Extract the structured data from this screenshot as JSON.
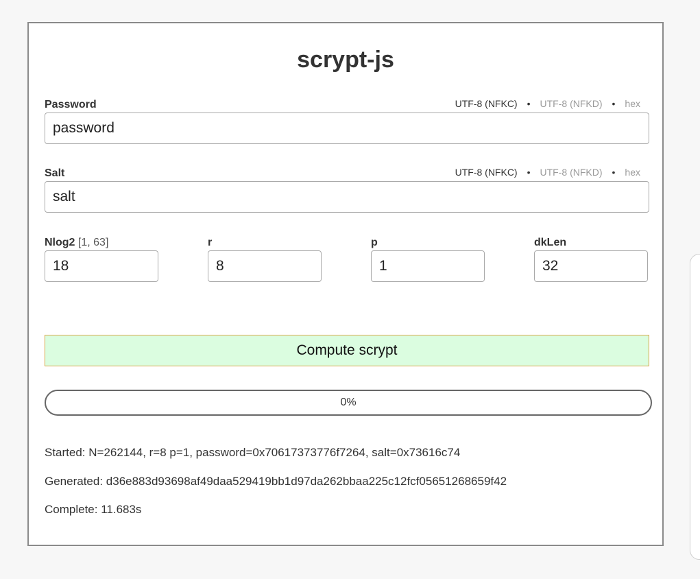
{
  "title": "scrypt-js",
  "password": {
    "label": "Password",
    "value": "password",
    "encodings": [
      "UTF-8 (NFKC)",
      "UTF-8 (NFKD)",
      "hex"
    ],
    "selected_encoding": "UTF-8 (NFKC)"
  },
  "salt": {
    "label": "Salt",
    "value": "salt",
    "encodings": [
      "UTF-8 (NFKC)",
      "UTF-8 (NFKD)",
      "hex"
    ],
    "selected_encoding": "UTF-8 (NFKC)"
  },
  "params": {
    "nlog2": {
      "label": "Nlog2",
      "range": "[1, 63]",
      "value": "18"
    },
    "r": {
      "label": "r",
      "value": "8"
    },
    "p": {
      "label": "p",
      "value": "1"
    },
    "dklen": {
      "label": "dkLen",
      "value": "32"
    }
  },
  "compute_label": "Compute scrypt",
  "progress": {
    "text": "0%",
    "fraction": 0
  },
  "log": {
    "started": "Started: N=262144, r=8 p=1, password=0x70617373776f7264, salt=0x73616c74",
    "generated": "Generated: d36e883d93698af49daa529419bb1d97da262bbaa225c12fcf05651268659f42",
    "complete": "Complete: 11.683s"
  },
  "colors": {
    "button_bg": "#dbfde0",
    "button_border": "#d8a84a",
    "dim_option": "#9a9a9a"
  }
}
